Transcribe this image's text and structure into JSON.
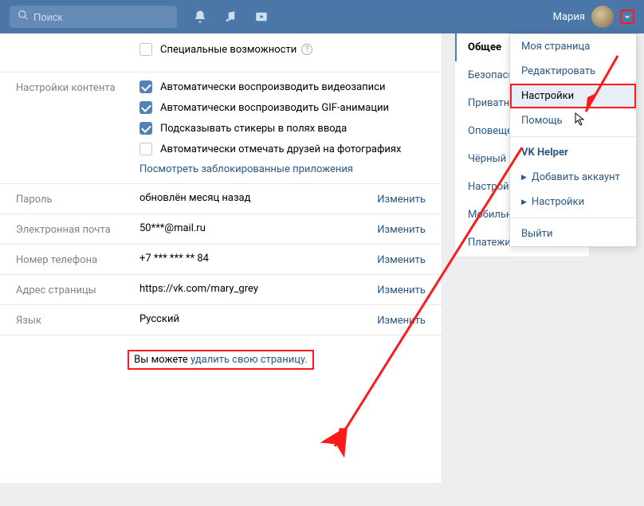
{
  "header": {
    "search_placeholder": "Поиск",
    "username": "Мария"
  },
  "accessibility": {
    "label": "Специальные возможности"
  },
  "content_settings": {
    "section_label": "Настройки контента",
    "opt_video": "Автоматически воспроизводить видеозаписи",
    "opt_gif": "Автоматически воспроизводить GIF-анимации",
    "opt_stickers": "Подсказывать стикеры в полях ввода",
    "opt_tag_friends": "Автоматически отмечать друзей на фотографиях",
    "blocked_apps_link": "Посмотреть заблокированные приложения"
  },
  "rows": {
    "password": {
      "label": "Пароль",
      "value": "обновлён месяц назад",
      "action": "Изменить"
    },
    "email": {
      "label": "Электронная почта",
      "value": "50***@mail.ru",
      "action": "Изменить"
    },
    "phone": {
      "label": "Номер телефона",
      "value": "+7 *** *** ** 84",
      "action": "Изменить"
    },
    "address": {
      "label": "Адрес страницы",
      "value": "https://vk.com/mary_grey",
      "action": "Изменить"
    },
    "language": {
      "label": "Язык",
      "value": "Русский",
      "action": "Изменить"
    }
  },
  "footer": {
    "prefix": "Вы можете ",
    "delete_link": "удалить свою страницу."
  },
  "sidebar": {
    "items": [
      "Общее",
      "Безопасность",
      "Приватность",
      "Оповещения",
      "Чёрный список",
      "Настройки приложений",
      "Мобильные сервисы",
      "Платежи"
    ]
  },
  "dropdown": {
    "my_page": "Моя страница",
    "edit": "Редактировать",
    "settings": "Настройки",
    "help": "Помощь",
    "vk_helper": "VK Helper",
    "add_account": "Добавить аккаунт",
    "helper_settings": "Настройки",
    "logout": "Выйти"
  }
}
